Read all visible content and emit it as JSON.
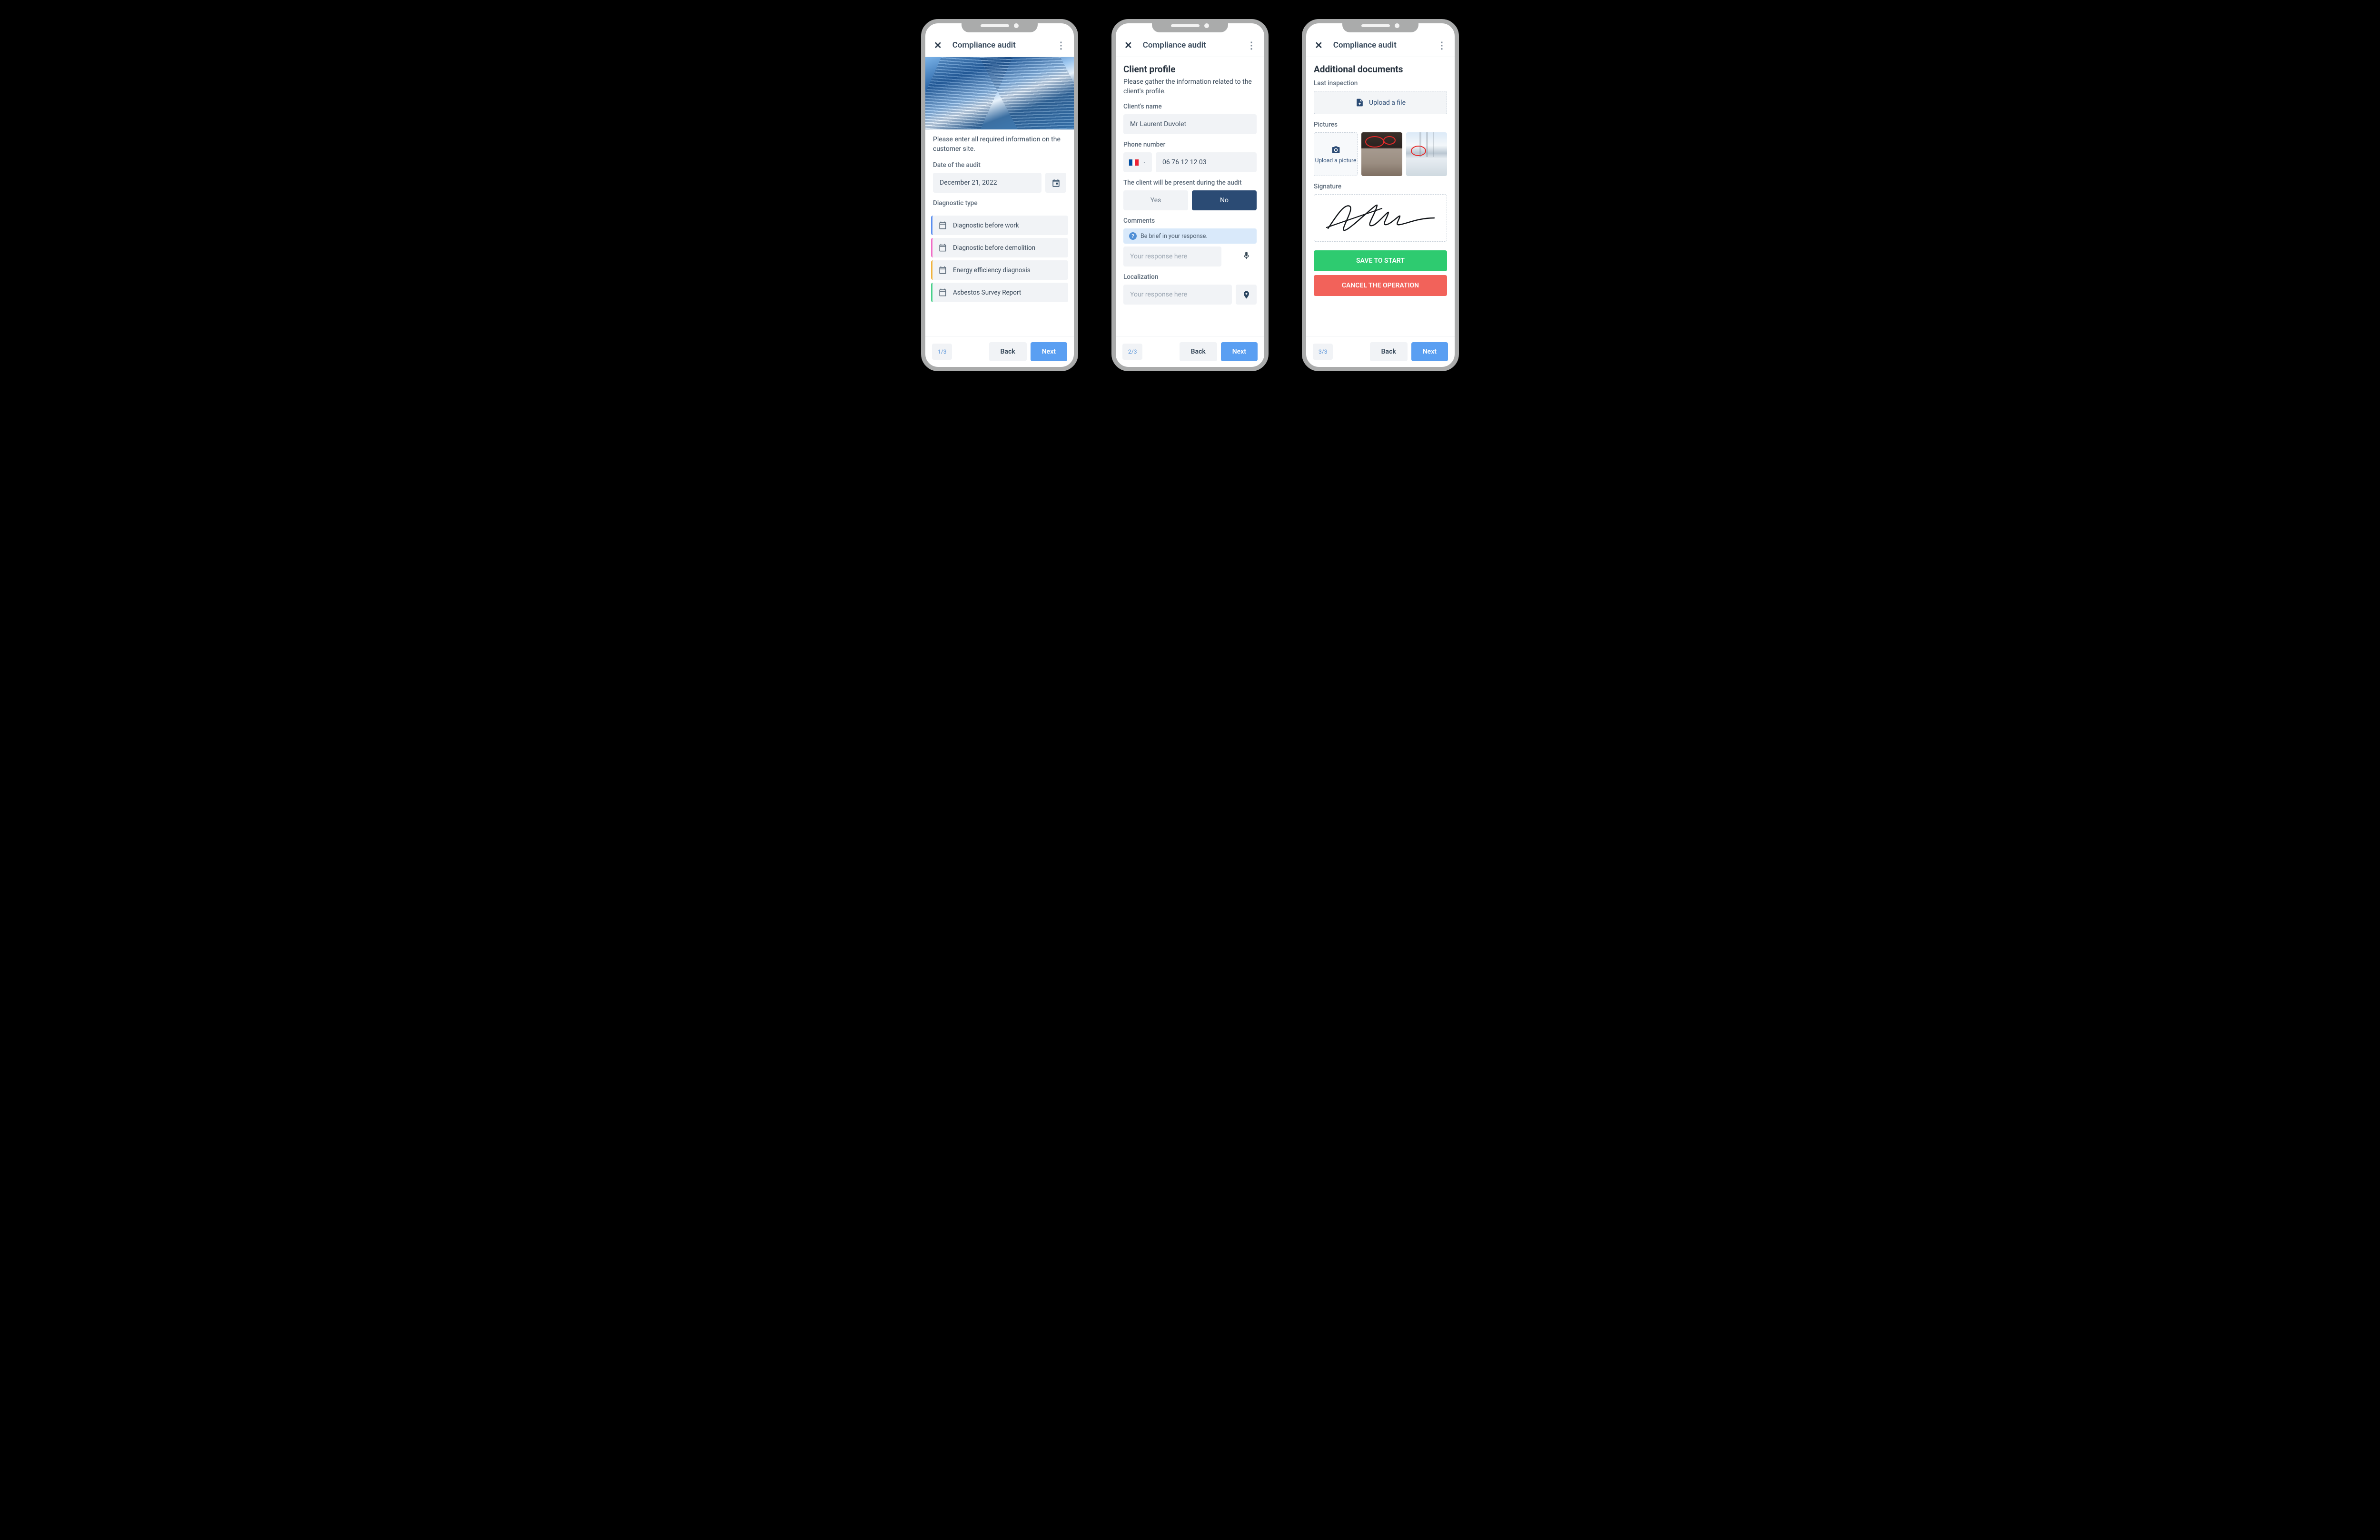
{
  "screen1": {
    "header_title": "Compliance audit",
    "intro": "Please enter all required information on the customer site.",
    "date_label": "Date of the audit",
    "date_value": "December 21, 2022",
    "diag_label": "Diagnostic type",
    "diag_options": [
      {
        "label": "Diagnostic before work",
        "accent": "#5a8ef0"
      },
      {
        "label": "Diagnostic before demolition",
        "accent": "#f06bc5"
      },
      {
        "label": "Energy efficiency diagnosis",
        "accent": "#f0b33c"
      },
      {
        "label": "Asbestos Survey Report",
        "accent": "#48d08a"
      }
    ],
    "page_indicator": "1/3",
    "back_label": "Back",
    "next_label": "Next"
  },
  "screen2": {
    "header_title": "Compliance audit",
    "section_title": "Client profile",
    "section_sub": "Please gather the information related to the client's profile.",
    "name_label": "Client's name",
    "name_value": "Mr Laurent Duvolet",
    "phone_label": "Phone number",
    "phone_value": "06 76 12 12 03",
    "country_flag_colors": [
      "#0050a4",
      "#ffffff",
      "#ee2436"
    ],
    "present_label": "The client will be present during the audit",
    "yes_label": "Yes",
    "no_label": "No",
    "comments_label": "Comments",
    "comments_hint": "Be brief in your response.",
    "comments_placeholder": "Your response here",
    "localization_label": "Localization",
    "localization_placeholder": "Your response here",
    "page_indicator": "2/3",
    "back_label": "Back",
    "next_label": "Next"
  },
  "screen3": {
    "header_title": "Compliance audit",
    "section_title": "Additional documents",
    "last_inspection_label": "Last inspection",
    "upload_file_label": "Upload a file",
    "pictures_label": "Pictures",
    "upload_picture_label": "Upload a picture",
    "signature_label": "Signature",
    "save_label": "SAVE TO START",
    "cancel_label": "CANCEL THE OPERATION",
    "page_indicator": "3/3",
    "back_label": "Back",
    "next_label": "Next"
  }
}
